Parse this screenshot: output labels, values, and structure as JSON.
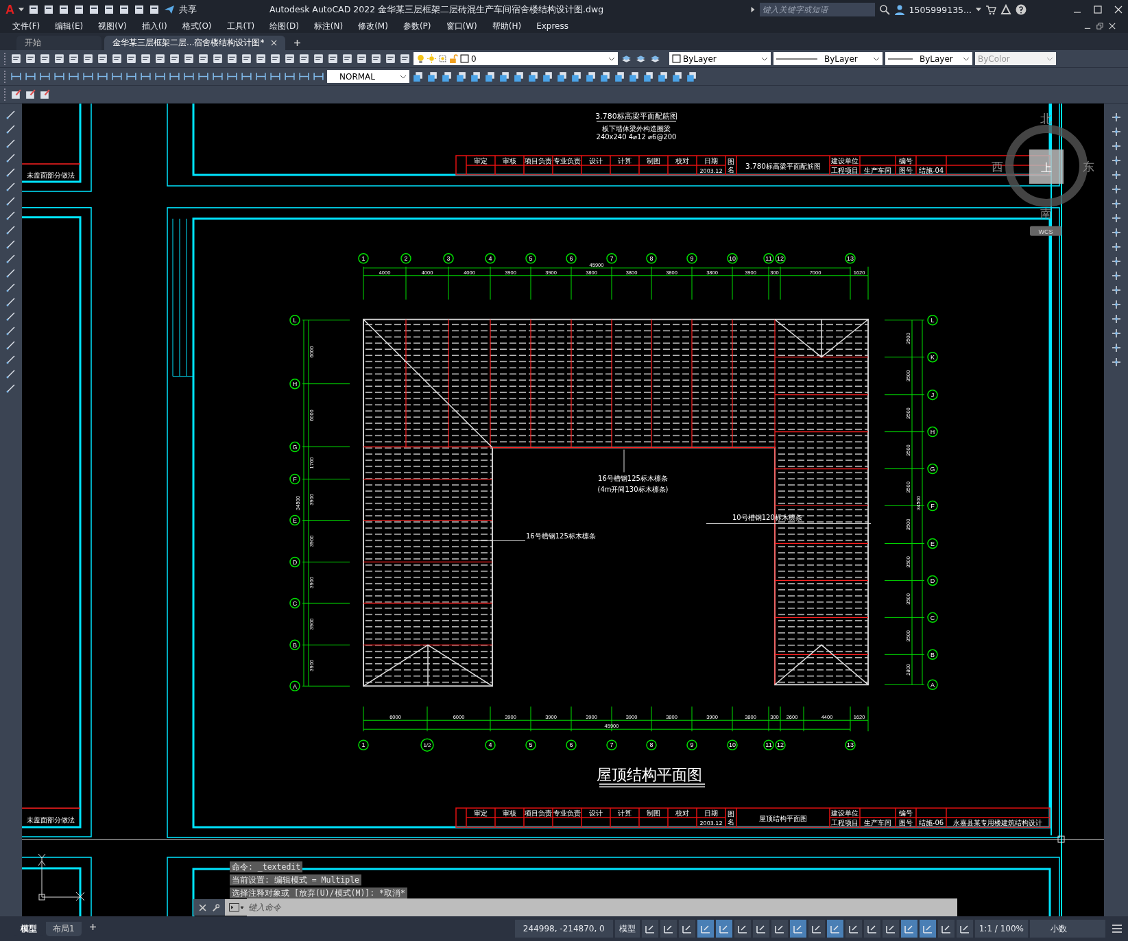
{
  "title_bar": {
    "logo": "A",
    "share": "共享",
    "title": "Autodesk AutoCAD 2022    金华某三层框架二层砖混生产车间宿舍楼结构设计图.dwg",
    "search": {
      "placeholder": "键入关键字或短语"
    },
    "user": "1505999135..."
  },
  "menu": [
    "文件(F)",
    "编辑(E)",
    "视图(V)",
    "插入(I)",
    "格式(O)",
    "工具(T)",
    "绘图(D)",
    "标注(N)",
    "修改(M)",
    "参数(P)",
    "窗口(W)",
    "帮助(H)",
    "Express"
  ],
  "tabs": [
    {
      "label": "开始",
      "selected": false
    },
    {
      "label": "金华某三层框架二层...宿舍楼结构设计图*",
      "selected": true
    }
  ],
  "toolbar": {
    "layer": "0",
    "color_control": "ByLayer",
    "linetype": "ByLayer",
    "lineweight": "ByLayer",
    "plot_style": {
      "value": "ByColor",
      "disabled": true
    },
    "text_style": "NORMAL"
  },
  "drawing": {
    "top_sheet": {
      "title": "3.780标高梁平面配筋图",
      "notes": [
        "板下墙体梁外构造圈梁",
        "240x240 4⌀12 ⌀6@200"
      ],
      "title_block": {
        "roles": [
          "审定",
          "审核",
          "项目负责",
          "专业负责",
          "设计",
          "计算",
          "制图",
          "校对"
        ],
        "date_label": "日期",
        "date": "2003.12",
        "name_label": "图名",
        "drawing_title": "3.780标高梁平面配筋图",
        "client_label": "建设单位",
        "project_label": "工程项目",
        "project": "生产车间",
        "number_label": "编号",
        "sheet_label": "图号",
        "sheet_no": "结施-04"
      }
    },
    "side_notes": [
      "未盖面部分做法",
      "未盖面部分做法"
    ],
    "plan": {
      "top_axes": [
        "1",
        "2",
        "3",
        "4",
        "5",
        "6",
        "7",
        "8",
        "9",
        "10",
        "11",
        "12",
        "13"
      ],
      "top_dims": [
        "4000",
        "4000",
        "4000",
        "3900",
        "3900",
        "3800",
        "3800",
        "3800",
        "3800",
        "3900",
        "300",
        "7000",
        "1620"
      ],
      "top_total": "45900",
      "bottom_axes": [
        "1",
        "1/2",
        "4",
        "5",
        "6",
        "7",
        "8",
        "9",
        "10",
        "11",
        "12",
        "13"
      ],
      "bottom_dims": [
        "6000",
        "6000",
        "3900",
        "3900",
        "3900",
        "3900",
        "3800",
        "3900",
        "3800",
        "300",
        "2600",
        "4400",
        "1620"
      ],
      "bottom_total": "45900",
      "left_axes": [
        "L",
        "H",
        "G",
        "F",
        "E",
        "D",
        "C",
        "B",
        "A"
      ],
      "left_dims": [
        "6000",
        "6000",
        "1700",
        "3900",
        "3900",
        "3900",
        "3900",
        "3900"
      ],
      "left_total": "34500",
      "right_axes": [
        "L",
        "K",
        "J",
        "H",
        "G",
        "F",
        "E",
        "D",
        "C",
        "B",
        "A"
      ],
      "right_dims": [
        "3500",
        "3500",
        "3500",
        "3500",
        "3500",
        "3500",
        "3500",
        "3500",
        "3500",
        "2800"
      ],
      "right_total": "34500",
      "annotations": [
        "16号槽钢125标木檩条",
        "(4m开间130标木檩条)",
        "10号槽钢120标木檩条",
        "16号槽钢125标木檩条"
      ],
      "title": "屋顶结构平面图",
      "title_block": {
        "roles": [
          "审定",
          "审核",
          "项目负责",
          "专业负责",
          "设计",
          "计算",
          "制图",
          "校对"
        ],
        "date_label": "日期",
        "date": "2003.12",
        "name_label": "图名",
        "drawing_title": "屋顶结构平面图",
        "client_label": "建设单位",
        "project_label": "工程项目",
        "project": "生产车间",
        "number_label": "编号",
        "sheet_label": "图号",
        "sheet_no": "结施-06",
        "note": "永嘉县某专用楼建筑结构设计"
      }
    },
    "view_cube": {
      "north": "北",
      "east": "东",
      "south": "南",
      "west": "西",
      "face": "上",
      "ucs": "WCS"
    }
  },
  "command_line": {
    "history": [
      "命令: _textedit",
      "当前设置: 编辑模式 = Multiple",
      "选择注释对象或 [放弃(U)/模式(M)]: *取消*"
    ],
    "placeholder": "键入命令"
  },
  "status_bar": {
    "layouts": [
      {
        "label": "模型",
        "selected": true
      },
      {
        "label": "布局1",
        "selected": false
      }
    ],
    "coordinates": "244998, -214870, 0",
    "space": "模型",
    "toggles": [
      {
        "on": false
      },
      {
        "on": false
      },
      {
        "on": false
      },
      {
        "on": true
      },
      {
        "on": true
      },
      {
        "on": false
      },
      {
        "on": false
      },
      {
        "on": false
      },
      {
        "on": true
      },
      {
        "on": false
      },
      {
        "on": true
      },
      {
        "on": false
      },
      {
        "on": false
      },
      {
        "on": false
      },
      {
        "on": true
      },
      {
        "on": true
      },
      {
        "on": false
      },
      {
        "on": false
      }
    ],
    "scale": "1:1 / 100%",
    "units": "小数"
  }
}
